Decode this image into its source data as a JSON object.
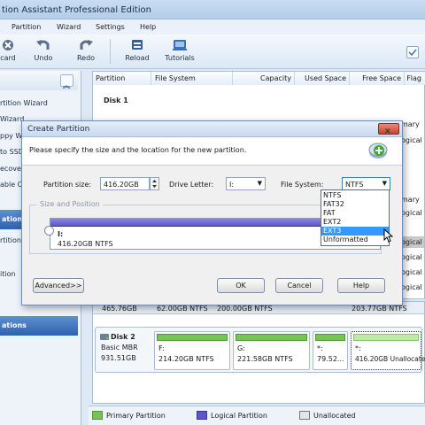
{
  "window": {
    "title": "tion Assistant Professional Edition"
  },
  "menu": [
    "Partition",
    "Wizard",
    "Settings",
    "Help"
  ],
  "toolbar": {
    "discard": "card",
    "undo": "Undo",
    "redo": "Redo",
    "reload": "Reload",
    "tutorials": "Tutorials"
  },
  "sidebar": {
    "items_top": [
      "rtition Wizard",
      "Wizard",
      "ppy Wiz",
      "to SSD",
      "ecover",
      "able CD"
    ],
    "section_operations": "ations",
    "items_ops": [
      "rtition",
      "ition"
    ],
    "section_information": "ations"
  },
  "grid": {
    "headers": [
      "Partition",
      "File System",
      "Capacity",
      "Used Space",
      "Free Space",
      "Flag"
    ],
    "disk1_label": "Disk 1",
    "flags": [
      "mary",
      "ogical",
      "mary",
      "ogical",
      "ogical",
      "ogical",
      "ogical",
      "ogical"
    ]
  },
  "diskmap": {
    "strip": [
      "465.76GB",
      "62.00GB NTFS",
      "200.00GB NTFS",
      "203.77GB NTFS"
    ],
    "disk2": {
      "name": "Disk 2",
      "type": "Basic MBR",
      "size": "931.51GB"
    },
    "parts": [
      {
        "label": "F:",
        "detail": "214.20GB NTFS"
      },
      {
        "label": "G:",
        "detail": "221.58GB NTFS"
      },
      {
        "label": "*:",
        "detail": "79.52..."
      },
      {
        "label": "*:",
        "detail": "416.20GB Unallocated"
      }
    ]
  },
  "legend": [
    "Primary Partition",
    "Logical Partition",
    "Unallocated"
  ],
  "dialog": {
    "title": "Create Partition",
    "instruction": "Please specify the size and the location for the new partition.",
    "size_label": "Partition size:",
    "size_value": "416.20GB",
    "drive_label": "Drive Letter:",
    "drive_value": "I:",
    "fs_label": "File System:",
    "fs_value": "NTFS",
    "group_label": "Size and Position",
    "bar_label": "I:",
    "bar_detail": "416.20GB NTFS",
    "advanced": "Advanced>>",
    "ok": "OK",
    "cancel": "Cancel",
    "help": "Help",
    "fs_options": [
      "NTFS",
      "FAT32",
      "FAT",
      "EXT2",
      "EXT3",
      "Unformatted"
    ],
    "fs_highlighted": "EXT3"
  },
  "colors": {
    "primary": "#78c257",
    "logical": "#5b57c9",
    "select": "#3399ff"
  }
}
